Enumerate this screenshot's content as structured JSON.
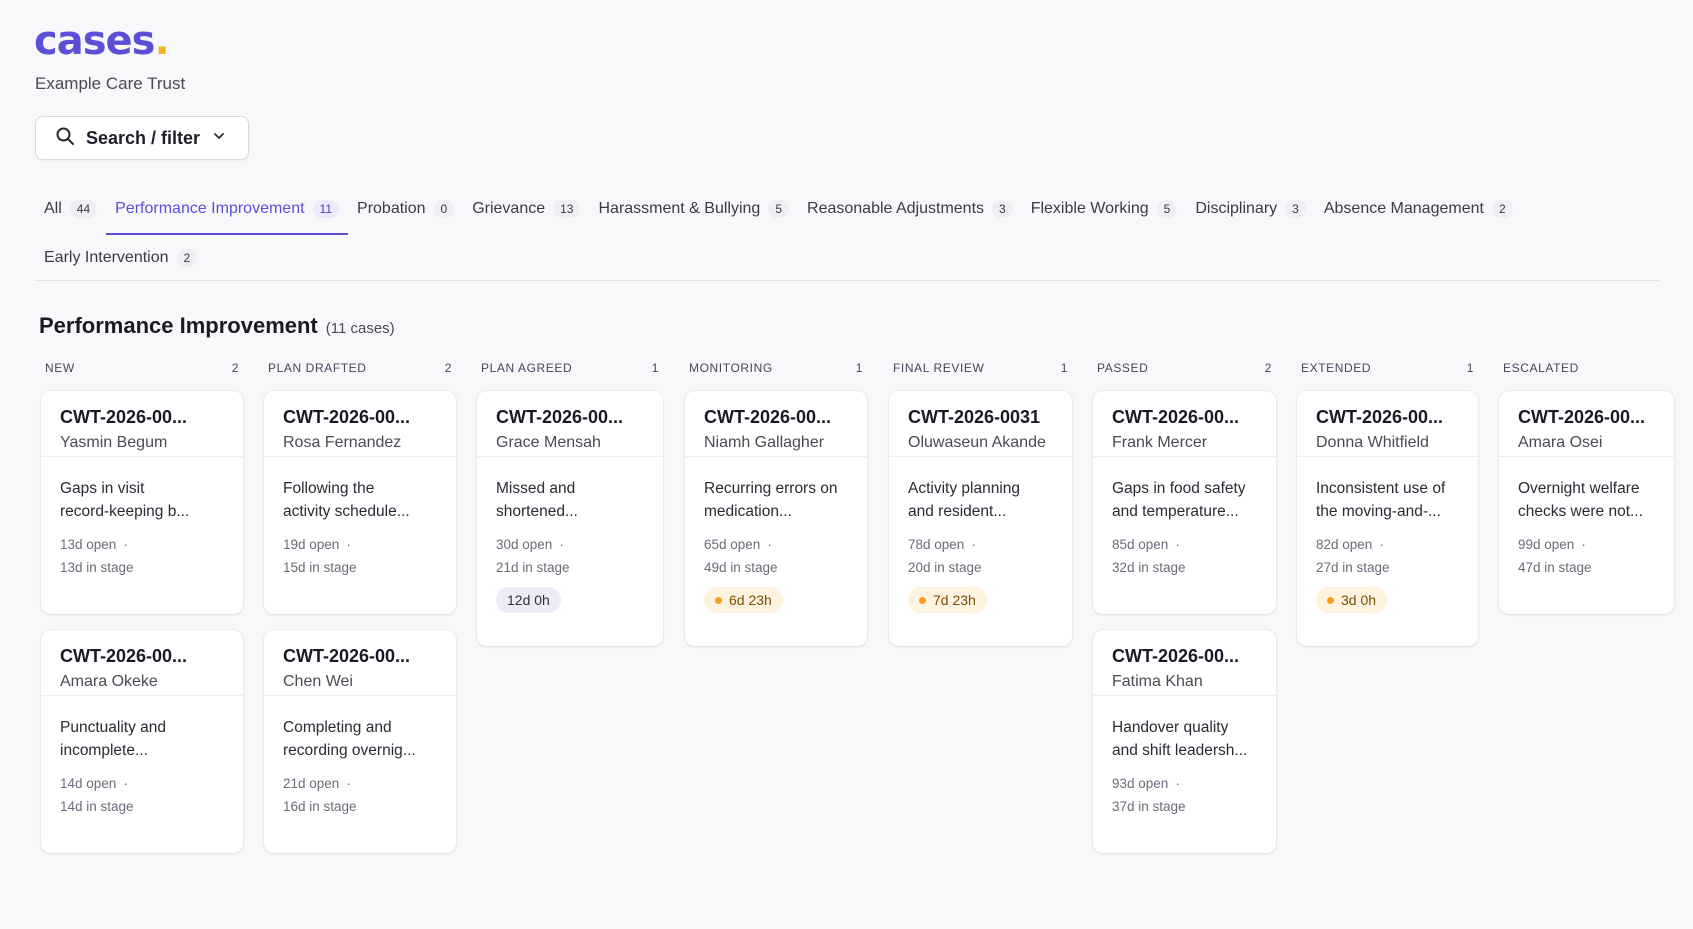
{
  "brand": {
    "logo": "cases",
    "logo_dot": ".",
    "org": "Example Care Trust"
  },
  "search": {
    "label": "Search / filter",
    "icon": "search-icon"
  },
  "tabs_row1": [
    {
      "label": "All",
      "count": "44"
    },
    {
      "label": "Performance Improvement",
      "count": "11",
      "active": true
    },
    {
      "label": "Probation",
      "count": "0"
    },
    {
      "label": "Grievance",
      "count": "13"
    },
    {
      "label": "Harassment & Bullying",
      "count": "5"
    },
    {
      "label": "Reasonable Adjustments",
      "count": "3"
    },
    {
      "label": "Flexible Working",
      "count": "5"
    },
    {
      "label": "Disciplinary",
      "count": "3"
    },
    {
      "label": "Absence Management",
      "count": "2"
    }
  ],
  "tabs_row2": [
    {
      "label": "Early Intervention",
      "count": "2"
    }
  ],
  "section": {
    "title": "Performance Improvement",
    "subtitle": "(11 cases)"
  },
  "colors": {
    "accent": "#5b4fd6",
    "logo_dot": "#f0b429",
    "warn_dot": "#f0a020"
  },
  "columns": [
    {
      "title": "NEW",
      "count": "2",
      "cards": [
        {
          "ref": "CWT-2026-00...",
          "name": "Yasmin Begum",
          "summary_1": "Gaps in visit",
          "summary_2": "record-keeping b...",
          "open": "13d open",
          "stage": "13d in stage"
        },
        {
          "ref": "CWT-2026-00...",
          "name": "Amara Okeke",
          "summary_1": "Punctuality and",
          "summary_2": "incomplete...",
          "open": "14d open",
          "stage": "14d in stage"
        }
      ]
    },
    {
      "title": "PLAN DRAFTED",
      "count": "2",
      "cards": [
        {
          "ref": "CWT-2026-00...",
          "name": "Rosa Fernandez",
          "summary_1": "Following the",
          "summary_2": "activity schedule...",
          "open": "19d open",
          "stage": "15d in stage"
        },
        {
          "ref": "CWT-2026-00...",
          "name": "Chen Wei",
          "summary_1": "Completing and",
          "summary_2": "recording overnig...",
          "open": "21d open",
          "stage": "16d in stage"
        }
      ]
    },
    {
      "title": "PLAN AGREED",
      "count": "1",
      "cards": [
        {
          "ref": "CWT-2026-00...",
          "name": "Grace Mensah",
          "summary_1": "Missed and",
          "summary_2": "shortened...",
          "open": "30d open",
          "stage": "21d in stage",
          "badge": "12d 0h",
          "badge_type": "neutral"
        }
      ]
    },
    {
      "title": "MONITORING",
      "count": "1",
      "cards": [
        {
          "ref": "CWT-2026-00...",
          "name": "Niamh Gallagher",
          "summary_1": "Recurring errors on",
          "summary_2": "medication...",
          "open": "65d open",
          "stage": "49d in stage",
          "badge": "6d 23h",
          "badge_type": "warn"
        }
      ]
    },
    {
      "title": "FINAL REVIEW",
      "count": "1",
      "cards": [
        {
          "ref": "CWT-2026-0031",
          "name": "Oluwaseun Akande",
          "summary_1": "Activity planning",
          "summary_2": "and resident...",
          "open": "78d open",
          "stage": "20d in stage",
          "badge": "7d 23h",
          "badge_type": "warn"
        }
      ]
    },
    {
      "title": "PASSED",
      "count": "2",
      "cards": [
        {
          "ref": "CWT-2026-00...",
          "name": "Frank Mercer",
          "summary_1": "Gaps in food safety",
          "summary_2": "and temperature...",
          "open": "85d open",
          "stage": "32d in stage"
        },
        {
          "ref": "CWT-2026-00...",
          "name": "Fatima Khan",
          "summary_1": "Handover quality",
          "summary_2": "and shift leadersh...",
          "open": "93d open",
          "stage": "37d in stage"
        }
      ]
    },
    {
      "title": "EXTENDED",
      "count": "1",
      "cards": [
        {
          "ref": "CWT-2026-00...",
          "name": "Donna Whitfield",
          "summary_1": "Inconsistent use of",
          "summary_2": "the moving-and-...",
          "open": "82d open",
          "stage": "27d in stage",
          "badge": "3d 0h",
          "badge_type": "warn"
        }
      ]
    },
    {
      "title": "ESCALATED",
      "count": "",
      "cards": [
        {
          "ref": "CWT-2026-00...",
          "name": "Amara Osei",
          "summary_1": "Overnight welfare",
          "summary_2": "checks were not...",
          "open": "99d open",
          "stage": "47d in stage"
        }
      ]
    }
  ]
}
